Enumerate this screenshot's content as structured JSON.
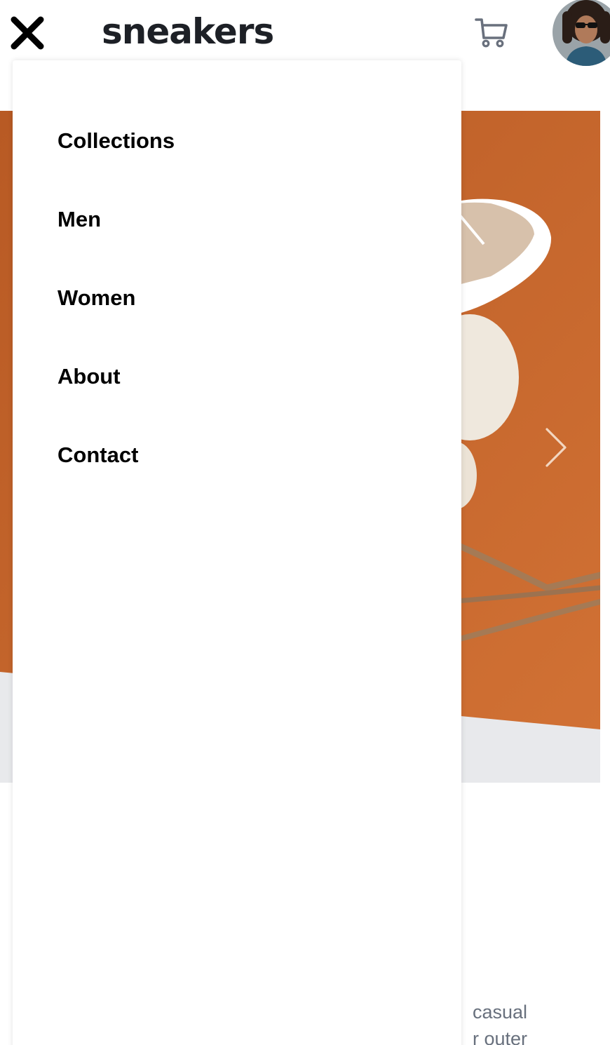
{
  "header": {
    "logo_text": "sneakers",
    "close_icon": "close-icon",
    "cart_icon": "cart-icon",
    "avatar": "user-avatar"
  },
  "menu": {
    "items": [
      {
        "label": "Collections"
      },
      {
        "label": "Men"
      },
      {
        "label": "Women"
      },
      {
        "label": "About"
      },
      {
        "label": "Contact"
      }
    ]
  },
  "gallery": {
    "next_icon": "chevron-right-icon"
  },
  "product": {
    "description_line1": "casual",
    "description_line2": "r outer"
  },
  "colors": {
    "accent_orange": "#c66a2c",
    "text_dark": "#1d2026",
    "text_gray": "#68707d"
  }
}
